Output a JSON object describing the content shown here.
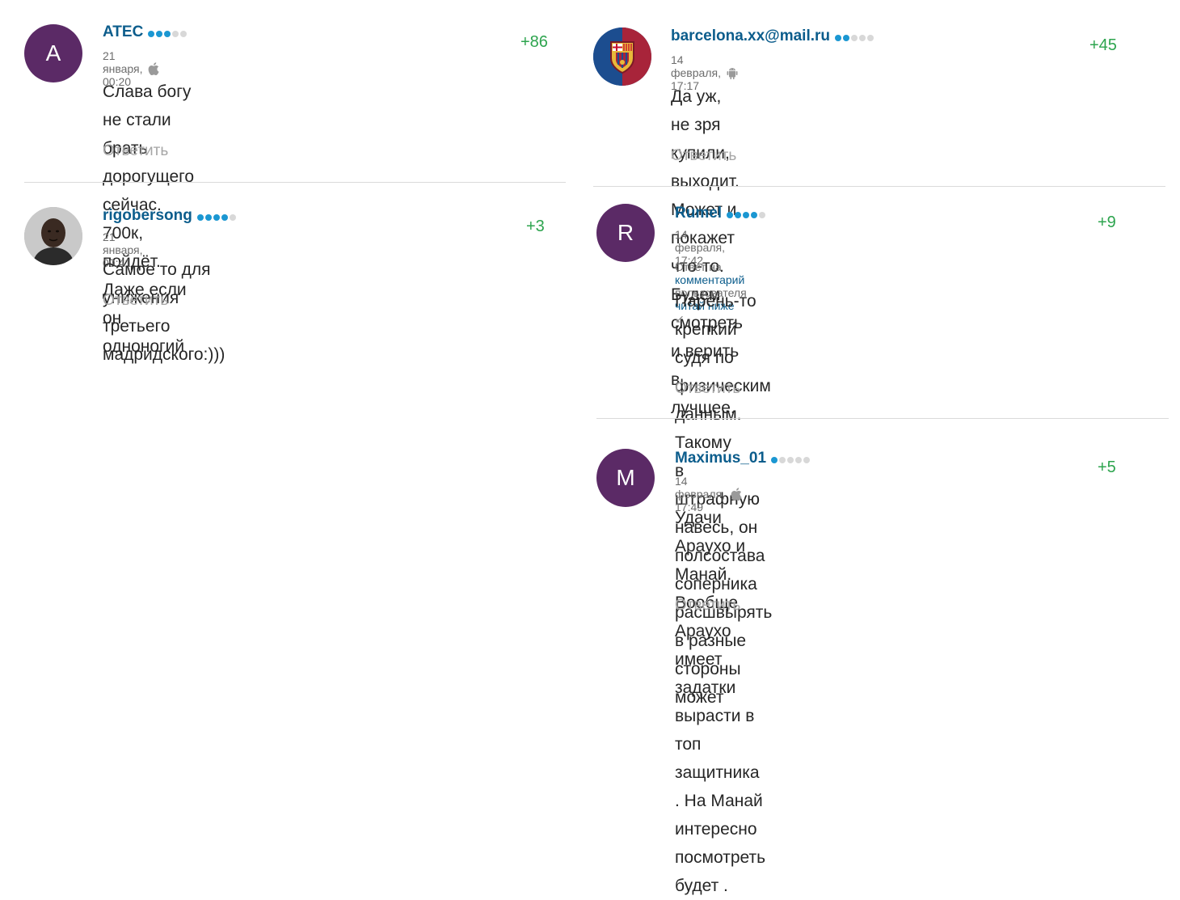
{
  "comments": [
    {
      "username": "ATEC",
      "rating_dots": 3,
      "date": "21 января, 00:20",
      "device": "apple-icon",
      "score": "+86",
      "lines": [
        "Слава богу не стали брать дорогущего сейчас. 700к,",
        "пойдёт. Даже если он одноногий"
      ],
      "reply_label": "Ответить",
      "avatar_letter": "A"
    },
    {
      "username": "rigobersong",
      "rating_dots": 4,
      "date": "21 января, 00:41",
      "score": "+3",
      "lines": [
        "Самое то для унижения третьего мадридского:)))"
      ],
      "reply_label": "Ответить"
    },
    {
      "username": "barcelona.xx@mail.ru",
      "rating_dots": 2,
      "date": "14 февраля, 17:17",
      "device": "android-icon",
      "score": "+45",
      "lines": [
        "Да уж, не зря купили, выходит. Может и покажет что-то.",
        "Будем смотреть и верить в лучшее."
      ],
      "reply_label": "Ответить"
    },
    {
      "username": "Rumel",
      "rating_dots": 4,
      "date": "14 февраля, 17:42",
      "score": "+9",
      "reply_to": {
        "prefix": "Ответ на",
        "link": "комментарий",
        "middle": "пользователя",
        "user": "читай ниже"
      },
      "lines": [
        "Парень-то крепкий судя по физическим данным. Такому",
        "в штрафную навесь, он полсостава соперника",
        "расшвырять в разные стороны может"
      ],
      "reply_label": "Ответить",
      "avatar_letter": "R"
    },
    {
      "username": "Maximus_01",
      "rating_dots": 1,
      "date": "14 февраля, 17:49",
      "device": "apple-icon",
      "score": "+5",
      "lines": [
        "Удачи Араухо и Манай. Вообще Араухо имеет задатки",
        "вырасти в топ защитника . На Манай интересно",
        "посмотреть будет ."
      ],
      "reply_label": "Ответить",
      "avatar_letter": "M"
    }
  ],
  "colors": {
    "username": "#0c5d8c",
    "score": "#2da44e",
    "avatar_bg": "#5b2a66",
    "dot_on": "#1b97d2",
    "dot_off": "#d8d8d8"
  }
}
